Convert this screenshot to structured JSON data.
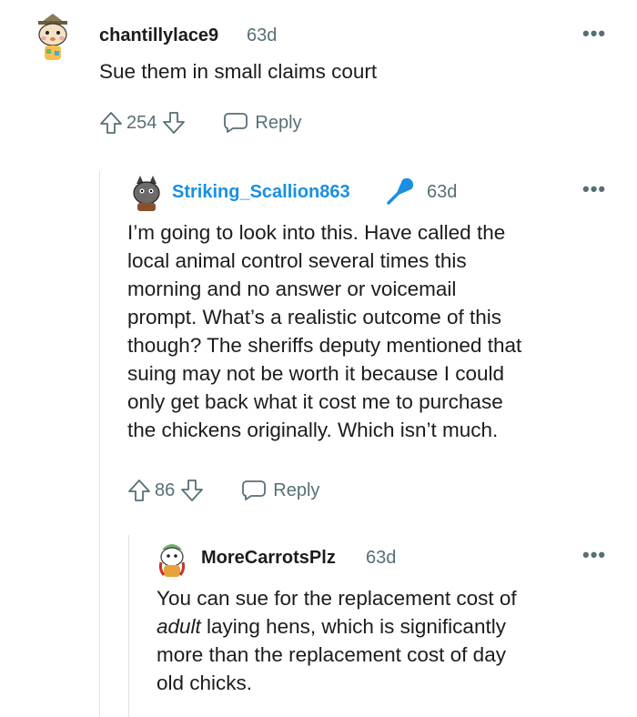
{
  "comments": [
    {
      "username": "chantillylace9",
      "age": "63d",
      "more": "•••",
      "body": "Sue them in small claims court",
      "upvotes": "254",
      "reply_label": "Reply"
    },
    {
      "username": "Striking_Scallion863",
      "age": "63d",
      "more": "•••",
      "is_op": true,
      "lines": [
        "I’m going to look into this. Have called the",
        "local animal control several times this",
        "morning and no answer or voicemail",
        "prompt. What’s a realistic outcome of this",
        "though? The sheriffs deputy mentioned that",
        "suing may not be worth it because I could",
        "only get back what it cost me to purchase",
        "the chickens originally. Which isn’t much."
      ],
      "upvotes": "86",
      "reply_label": "Reply"
    },
    {
      "username": "MoreCarrotsPlz",
      "age": "63d",
      "more": "•••",
      "line1": "You can sue for the replacement cost of",
      "line2_em": "adult",
      "line2_rest": " laying hens, which is significantly",
      "line3": "more than the replacement cost of day",
      "line4": "old chicks."
    }
  ],
  "colors": {
    "op_username": "#1a8fe3",
    "meta": "#576f76"
  }
}
